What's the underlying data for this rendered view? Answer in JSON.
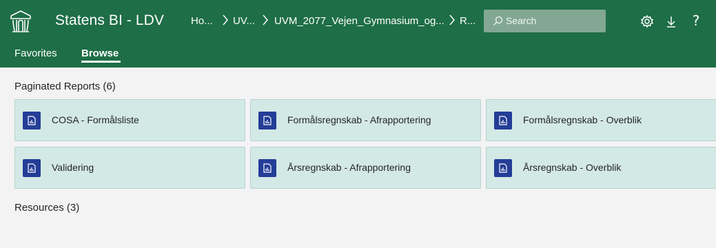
{
  "header": {
    "app_title": "Statens BI - LDV",
    "breadcrumb": [
      "Ho...",
      "UV...",
      "UVM_2077_Vejen_Gymnasium_og...",
      "R..."
    ],
    "breadcrumb_separator": ">",
    "search_placeholder": "Search",
    "icons": [
      "logo-icon",
      "search-icon",
      "settings-icon",
      "download-icon",
      "help-icon"
    ],
    "help_label": "?"
  },
  "nav": {
    "tabs": [
      {
        "label": "Favorites",
        "active": false
      },
      {
        "label": "Browse",
        "active": true
      }
    ]
  },
  "sections": {
    "paginated_reports": {
      "title": "Paginated Reports (6)",
      "items": [
        {
          "label": "COSA - Formålsliste"
        },
        {
          "label": "Formålsregnskab - Afrapportering"
        },
        {
          "label": "Formålsregnskab - Overblik"
        },
        {
          "label": "Validering"
        },
        {
          "label": "Årsregnskab - Afrapportering"
        },
        {
          "label": "Årsregnskab - Overblik"
        }
      ]
    },
    "resources": {
      "title": "Resources (3)"
    }
  },
  "colors": {
    "header_bg": "#1e6e47",
    "tile_bg": "#d3e9e6",
    "report_icon_bg": "#243d97",
    "page_bg": "#f3f3f3"
  }
}
